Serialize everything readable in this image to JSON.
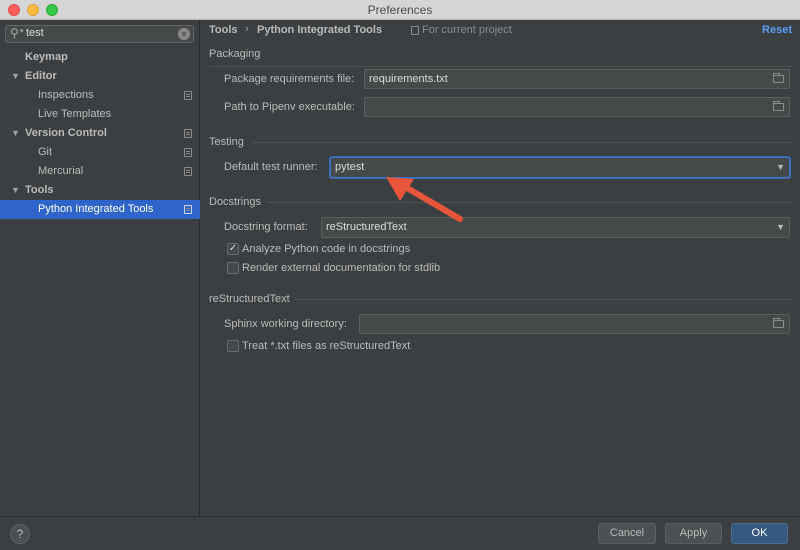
{
  "window": {
    "title": "Preferences"
  },
  "search": {
    "value": "test"
  },
  "sidebar": {
    "items": [
      {
        "label": "Keymap"
      },
      {
        "label": "Editor"
      },
      {
        "label": "Inspections"
      },
      {
        "label": "Live Templates"
      },
      {
        "label": "Version Control"
      },
      {
        "label": "Git"
      },
      {
        "label": "Mercurial"
      },
      {
        "label": "Tools"
      },
      {
        "label": "Python Integrated Tools"
      }
    ]
  },
  "header": {
    "breadcrumb_root": "Tools",
    "breadcrumb_separator": "›",
    "breadcrumb_current": "Python Integrated Tools",
    "scope": "For current project",
    "reset_label": "Reset"
  },
  "packaging": {
    "title": "Packaging",
    "requirements_label": "Package requirements file:",
    "requirements_value": "requirements.txt",
    "pipenv_label": "Path to Pipenv executable:",
    "pipenv_value": ""
  },
  "testing": {
    "title": "Testing",
    "runner_label": "Default test runner:",
    "runner_value": "pytest"
  },
  "docstrings": {
    "title": "Docstrings",
    "format_label": "Docstring format:",
    "format_value": "reStructuredText",
    "analyze_label": "Analyze Python code in docstrings",
    "analyze_checked": true,
    "render_label": "Render external documentation for stdlib",
    "render_checked": false
  },
  "rest": {
    "title": "reStructuredText",
    "sphinx_label": "Sphinx working directory:",
    "sphinx_value": "",
    "treat_label": "Treat *.txt files as reStructuredText",
    "treat_checked": false
  },
  "footer": {
    "help_label": "?",
    "cancel_label": "Cancel",
    "apply_label": "Apply",
    "ok_label": "OK"
  },
  "colors": {
    "background": "#3c3f41",
    "selection": "#2f65ca",
    "link": "#589df6",
    "annotation_arrow": "#e8553a",
    "primary_button": "#365880"
  },
  "icons": {
    "search": "search-icon",
    "clear": "clear-icon",
    "tree_expanded": "chevron-down-icon",
    "project_scope": "project-scope-icon",
    "folder": "folder-icon",
    "dropdown": "dropdown-arrow-icon"
  }
}
